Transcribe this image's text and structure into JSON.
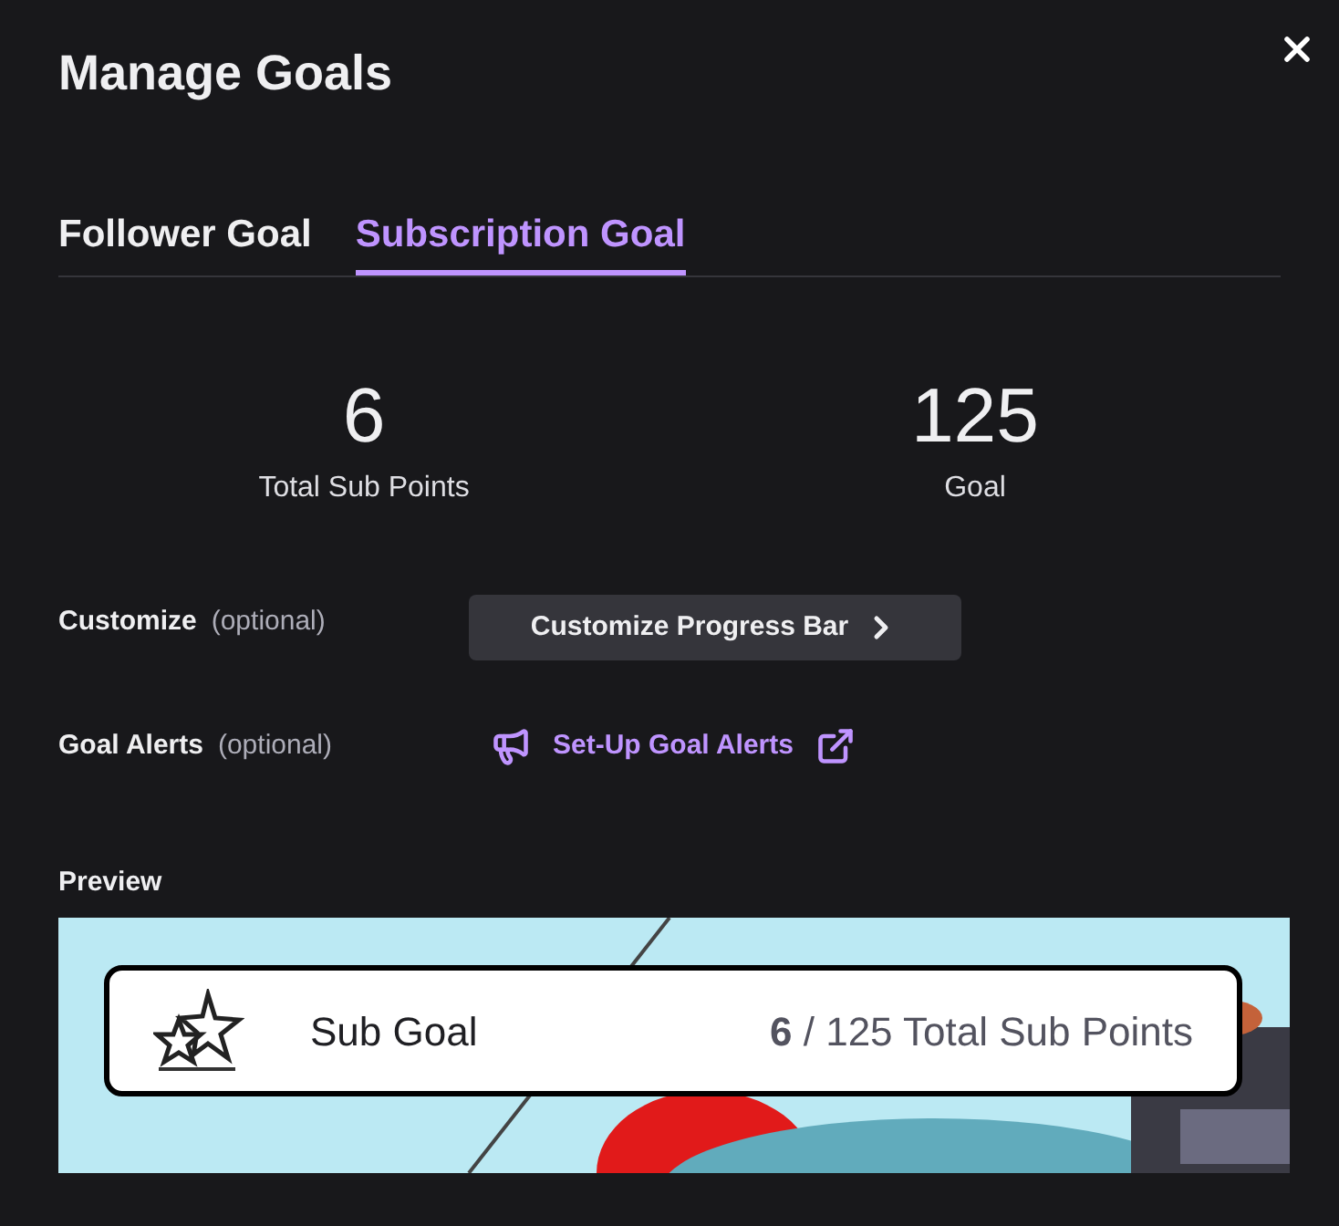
{
  "title": "Manage Goals",
  "tabs": [
    {
      "label": "Follower Goal",
      "selected": false
    },
    {
      "label": "Subscription Goal",
      "selected": true
    }
  ],
  "stats": [
    {
      "value": "6",
      "label": "Total Sub Points"
    },
    {
      "value": "125",
      "label": "Goal"
    }
  ],
  "options": [
    {
      "kind": "button",
      "label": "Customize",
      "hint": "(optional)",
      "action": "Customize Progress Bar"
    },
    {
      "kind": "link",
      "label": "Goal Alerts",
      "hint": "(optional)",
      "action": "Set-Up Goal Alerts"
    }
  ],
  "preview": {
    "label": "Preview",
    "goal_name": "Sub Goal",
    "progress": "**6** / 125 Total Sub Points"
  }
}
